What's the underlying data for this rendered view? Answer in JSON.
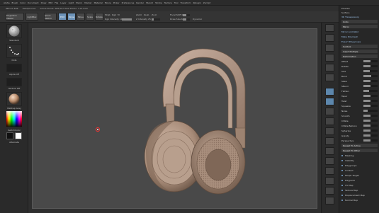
{
  "menu": [
    "Alpha",
    "Brush",
    "Color",
    "Document",
    "Draw",
    "Edit",
    "File",
    "Layer",
    "Light",
    "Macro",
    "Marker",
    "Material",
    "Movie",
    "Picker",
    "Preferences",
    "Render",
    "Stencil",
    "Stroke",
    "Texture",
    "Tool",
    "Transform",
    "Zplugin",
    "Zscript"
  ],
  "title": {
    "app": "ZBrush 4R6",
    "doc": "Headphones",
    "info": "Active Points: 965,097   Total Points: 3.211 Mil"
  },
  "shelf": {
    "projection_master": "Projection Master",
    "lightbox": "LightBox",
    "quick_sketch": "Quick Sketch",
    "edit": "Edit",
    "draw": "Draw",
    "move": "Move",
    "scale": "Scale",
    "rotate": "Rotate",
    "mrgb": "Mrgb",
    "rgb": "Rgb",
    "m": "M",
    "zadd": "Zadd",
    "zsub": "Zsub",
    "zcut": "Zcut",
    "rgb_intensity": "Rgb Intensity 100",
    "z_intensity": "Z Intensity 25",
    "focal_shift": "Focal Shift 0",
    "draw_size": "Draw Size 64",
    "dynamic": "Dynamic",
    "rgb_intensity_value": 1.0,
    "z_intensity_value": 0.25,
    "focal_shift_value": 0.5,
    "draw_size_value": 0.5
  },
  "left": {
    "brush_label": "Standard",
    "stroke_label": "Dots",
    "alpha_label": "Alpha Off",
    "texture_label": "Texture Off",
    "material_label": "MatCap Gray",
    "gradient_label": "Gradient",
    "switch_label": "SwitchColor",
    "alternate_label": "Alternate"
  },
  "tray": {
    "top": [
      "Preview",
      "Surface",
      "3D Transparency"
    ],
    "rows": [
      {
        "label": "Undo",
        "type": "hdr"
      },
      {
        "label": "Mirror",
        "type": "hdr"
      },
      {
        "label": "Mirror And Weld",
        "type": "blue"
      },
      {
        "label": "Make Polymesh",
        "type": "blue"
      },
      {
        "label": "Export Polygroups",
        "type": "blue"
      },
      {
        "label": "Subtool",
        "type": "hdr"
      },
      {
        "label": "Insert Multiple",
        "type": "hdr"
      },
      {
        "label": "Deformation",
        "type": "hdr"
      },
      {
        "label": "Offset",
        "type": "slider",
        "value": 0.5
      },
      {
        "label": "Rotate",
        "type": "slider",
        "value": 0.5
      },
      {
        "label": "Size",
        "type": "slider",
        "value": 0.45
      },
      {
        "label": "Bend",
        "type": "slider",
        "value": 0.55
      },
      {
        "label": "Skew",
        "type": "slider",
        "value": 0.5
      },
      {
        "label": "SBend",
        "type": "slider",
        "value": 0.5
      },
      {
        "label": "Flatten",
        "type": "slider",
        "value": 0.4
      },
      {
        "label": "Taper",
        "type": "slider",
        "value": 0.5
      },
      {
        "label": "Twist",
        "type": "slider",
        "value": 0.5
      },
      {
        "label": "Squeeze",
        "type": "slider",
        "value": 0.5
      },
      {
        "label": "Noise",
        "type": "slider",
        "value": 0.3
      },
      {
        "label": "Smooth",
        "type": "slider",
        "value": 0.5
      },
      {
        "label": "Inflate",
        "type": "slider",
        "value": 0.5
      },
      {
        "label": "Inflate Balloon",
        "type": "slider",
        "value": 0.5
      },
      {
        "label": "Spherize",
        "type": "slider",
        "value": 0.5
      },
      {
        "label": "Gravity",
        "type": "slider",
        "value": 0.5
      },
      {
        "label": "Perspective",
        "type": "slider",
        "value": 0.5
      },
      {
        "label": "Repeat To Active",
        "type": "hdr"
      },
      {
        "label": "Repeat To Other",
        "type": "hdr"
      },
      {
        "label": "Masking",
        "type": "item"
      },
      {
        "label": "Visibility",
        "type": "item"
      },
      {
        "label": "Polygroups",
        "type": "item"
      },
      {
        "label": "Contact",
        "type": "item"
      },
      {
        "label": "Morph Target",
        "type": "item"
      },
      {
        "label": "Polypaint",
        "type": "item"
      },
      {
        "label": "UV Map",
        "type": "item"
      },
      {
        "label": "Texture Map",
        "type": "item"
      },
      {
        "label": "Displacement Map",
        "type": "item"
      },
      {
        "label": "Normal Map",
        "type": "item"
      }
    ]
  },
  "colors": {
    "accent": "#6d93b8",
    "model": "#b59a88",
    "canvas": "#494949"
  },
  "icons": [
    "sphere-brush-icon",
    "dots-stroke-icon",
    "alpha-icon",
    "material-sphere-icon",
    "color-picker-icon",
    "cursor-icon",
    "headphones-model"
  ]
}
